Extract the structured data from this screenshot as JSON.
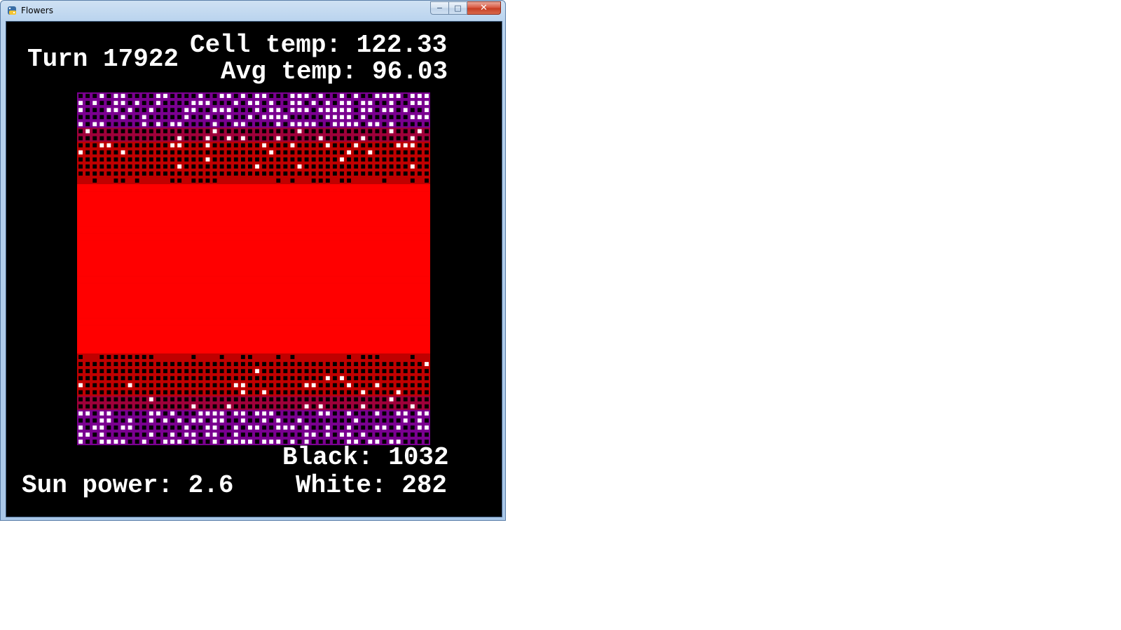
{
  "window": {
    "title": "Flowers",
    "icon": "python-icon"
  },
  "caption": {
    "minimize": "−",
    "maximize": "□",
    "close": "✕"
  },
  "hud": {
    "turn": "Turn 17922",
    "cell_temp": "Cell temp: 122.33",
    "avg_temp": "Avg temp: 96.03",
    "black": "Black: 1032",
    "sun_power": "Sun power: 2.6",
    "white": "White: 282"
  },
  "grid": {
    "rows": 50,
    "cols": 50,
    "colors": {
      "hot": "#ff0000",
      "black_flower": "#000000",
      "white_flower": "#ffffff",
      "warm_cell": "#c00000",
      "mid_cell": "#a0003a",
      "cool_cell": "#7a0090"
    }
  }
}
